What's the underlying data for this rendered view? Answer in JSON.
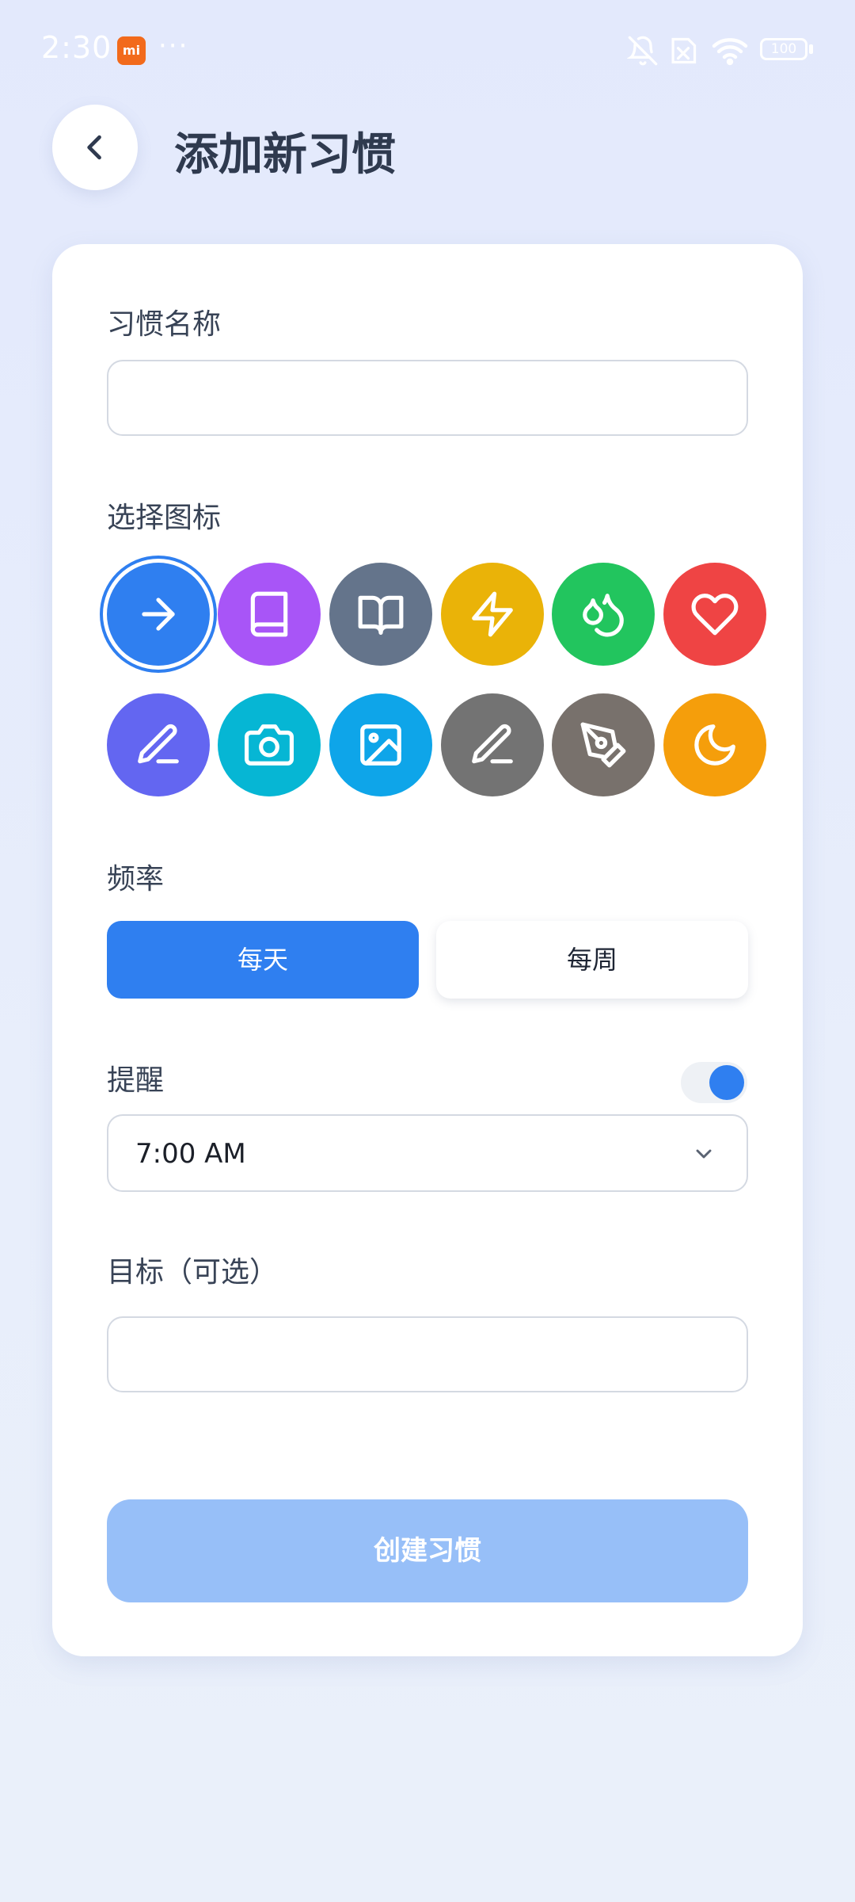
{
  "status_bar": {
    "time": "2:30",
    "brand_badge": "mi",
    "more": "···",
    "battery": "100"
  },
  "header": {
    "title": "添加新习惯"
  },
  "form": {
    "name_label": "习惯名称",
    "name_value": "",
    "icon_label": "选择图标",
    "icons": [
      {
        "name": "arrow-right",
        "color": "#2f7ff0",
        "selected": true
      },
      {
        "name": "book",
        "color": "#a855f7",
        "selected": false
      },
      {
        "name": "book-open",
        "color": "#64748b",
        "selected": false
      },
      {
        "name": "zap",
        "color": "#eab308",
        "selected": false
      },
      {
        "name": "droplets",
        "color": "#22c55e",
        "selected": false
      },
      {
        "name": "heart",
        "color": "#ef4444",
        "selected": false
      },
      {
        "name": "pencil",
        "color": "#6366f1",
        "selected": false
      },
      {
        "name": "camera",
        "color": "#06b6d4",
        "selected": false
      },
      {
        "name": "image",
        "color": "#0ea5e9",
        "selected": false
      },
      {
        "name": "pencil",
        "color": "#737373",
        "selected": false
      },
      {
        "name": "pen-tool",
        "color": "#78716c",
        "selected": false
      },
      {
        "name": "moon",
        "color": "#f59e0b",
        "selected": false
      }
    ],
    "frequency_label": "频率",
    "frequency_options": [
      "每天",
      "每周"
    ],
    "frequency_selected": "每天",
    "reminder_label": "提醒",
    "reminder_enabled": true,
    "reminder_time": "7:00 AM",
    "goal_label": "目标（可选）",
    "goal_value": "",
    "submit_label": "创建习惯"
  },
  "colors": {
    "accent": "#2f7ff0",
    "submit_disabled": "#97bff8",
    "background": "#e4eafb"
  }
}
